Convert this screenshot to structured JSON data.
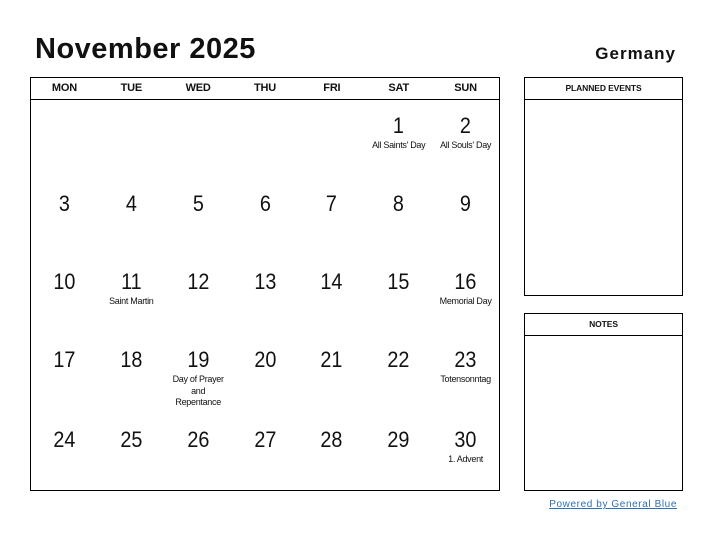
{
  "header": {
    "title": "November 2025",
    "country": "Germany"
  },
  "calendar": {
    "weekdays": [
      "MON",
      "TUE",
      "WED",
      "THU",
      "FRI",
      "SAT",
      "SUN"
    ],
    "weeks": [
      [
        {
          "day": "",
          "holiday": ""
        },
        {
          "day": "",
          "holiday": ""
        },
        {
          "day": "",
          "holiday": ""
        },
        {
          "day": "",
          "holiday": ""
        },
        {
          "day": "",
          "holiday": ""
        },
        {
          "day": "1",
          "holiday": "All Saints' Day"
        },
        {
          "day": "2",
          "holiday": "All Souls' Day"
        }
      ],
      [
        {
          "day": "3",
          "holiday": ""
        },
        {
          "day": "4",
          "holiday": ""
        },
        {
          "day": "5",
          "holiday": ""
        },
        {
          "day": "6",
          "holiday": ""
        },
        {
          "day": "7",
          "holiday": ""
        },
        {
          "day": "8",
          "holiday": ""
        },
        {
          "day": "9",
          "holiday": ""
        }
      ],
      [
        {
          "day": "10",
          "holiday": ""
        },
        {
          "day": "11",
          "holiday": "Saint Martin"
        },
        {
          "day": "12",
          "holiday": ""
        },
        {
          "day": "13",
          "holiday": ""
        },
        {
          "day": "14",
          "holiday": ""
        },
        {
          "day": "15",
          "holiday": ""
        },
        {
          "day": "16",
          "holiday": "Memorial Day"
        }
      ],
      [
        {
          "day": "17",
          "holiday": ""
        },
        {
          "day": "18",
          "holiday": ""
        },
        {
          "day": "19",
          "holiday": "Day of Prayer and Repentance"
        },
        {
          "day": "20",
          "holiday": ""
        },
        {
          "day": "21",
          "holiday": ""
        },
        {
          "day": "22",
          "holiday": ""
        },
        {
          "day": "23",
          "holiday": "Totensonntag"
        }
      ],
      [
        {
          "day": "24",
          "holiday": ""
        },
        {
          "day": "25",
          "holiday": ""
        },
        {
          "day": "26",
          "holiday": ""
        },
        {
          "day": "27",
          "holiday": ""
        },
        {
          "day": "28",
          "holiday": ""
        },
        {
          "day": "29",
          "holiday": ""
        },
        {
          "day": "30",
          "holiday": "1. Advent"
        }
      ]
    ]
  },
  "panels": {
    "planned_events": "PLANNED EVENTS",
    "notes": "NOTES"
  },
  "footer": {
    "powered_by": "Powered by General Blue",
    "link_color": "#2f6fb6"
  }
}
